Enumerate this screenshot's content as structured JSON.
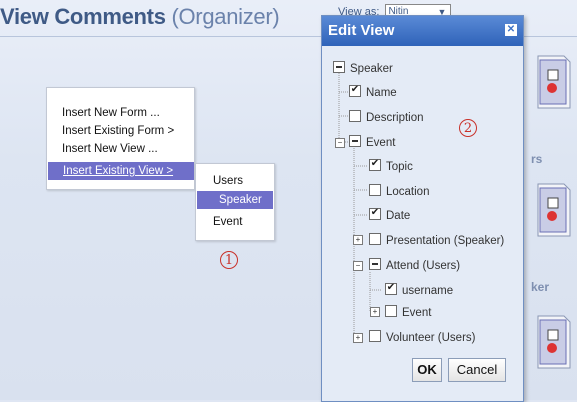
{
  "page": {
    "title": "View Comments",
    "title_suffix": "(Organizer)",
    "view_as_label": "View as:",
    "view_as_value": "Nitin",
    "right_labels": [
      "rs",
      "ker"
    ]
  },
  "context_menu": {
    "items": [
      {
        "label": "Insert New Form ...",
        "active": false
      },
      {
        "label": "Insert Existing Form >",
        "active": false
      },
      {
        "label": "Insert New View ...",
        "active": false
      },
      {
        "label": "Insert Existing View >",
        "active": true
      }
    ],
    "submenu": [
      {
        "label": "Users",
        "active": false
      },
      {
        "label": "Speaker",
        "active": true
      },
      {
        "label": "Event",
        "active": false
      }
    ]
  },
  "markers": {
    "one": "1",
    "two": "2"
  },
  "dialog": {
    "title": "Edit View",
    "close_icon": "close-icon",
    "tree": [
      {
        "label": "Speaker",
        "state": "partial"
      },
      {
        "label": "Name",
        "state": "checked"
      },
      {
        "label": "Description",
        "state": "unchecked"
      },
      {
        "label": "Event",
        "state": "partial"
      },
      {
        "label": "Topic",
        "state": "checked"
      },
      {
        "label": "Location",
        "state": "unchecked"
      },
      {
        "label": "Date",
        "state": "checked"
      },
      {
        "label": "Presentation (Speaker)",
        "state": "unchecked"
      },
      {
        "label": "Attend (Users)",
        "state": "partial"
      },
      {
        "label": "username",
        "state": "checked"
      },
      {
        "label": "Event",
        "state": "unchecked"
      },
      {
        "label": "Volunteer (Users)",
        "state": "unchecked"
      }
    ],
    "ok_label": "OK",
    "cancel_label": "Cancel"
  },
  "colors": {
    "accent": "#3f73c7",
    "menu_highlight": "#6f6fc9",
    "marker": "#c9312a"
  }
}
